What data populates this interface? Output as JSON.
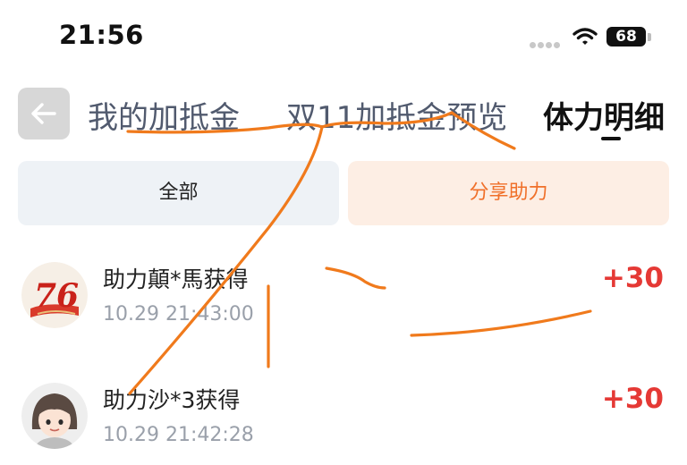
{
  "status_bar": {
    "time": "21:56",
    "battery": "68"
  },
  "header": {
    "tabs": [
      {
        "label": "我的加抵金"
      },
      {
        "label": "双11加抵金预览"
      },
      {
        "label": "体力明细"
      }
    ]
  },
  "filters": {
    "all_label": "全部",
    "share_label": "分享助力"
  },
  "records": [
    {
      "title": "助力顛*馬获得",
      "time": "10.29 21:43:00",
      "points": "+30"
    },
    {
      "title": "助力沙*3获得",
      "time": "10.29 21:42:28",
      "points": "+30"
    }
  ],
  "colors": {
    "accent_orange": "#f0702a",
    "points_red": "#e53935",
    "annotation_orange": "#f07a1c"
  }
}
